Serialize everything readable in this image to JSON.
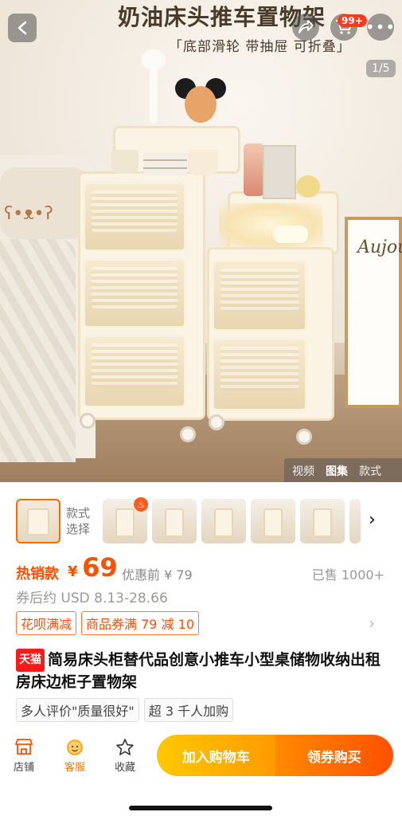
{
  "hero": {
    "title": "奶油床头推车置物架",
    "subtitle": "「底部滑轮 带抽屉 可折叠」",
    "cart_badge": "99+",
    "image_counter": "1/5",
    "media_tabs": [
      "视频",
      "图集",
      "款式"
    ],
    "active_media_tab": "图集",
    "frame_text": "Aujou"
  },
  "thumbs": {
    "style_label": "款式选择"
  },
  "price": {
    "hot_label": "热销款",
    "currency": "¥",
    "value": "69",
    "original": "优惠前 ¥ 79",
    "sold": "已售 1000+",
    "usd": "券后约 USD 8.13-28.66"
  },
  "promos": [
    "花呗满减",
    "商品券满 79 减 10"
  ],
  "product": {
    "badge": "天猫",
    "title": "简易床头柜替代品创意小推车小型桌储物收纳出租房床边柜子置物架"
  },
  "tags": [
    "多人评价\"质量很好\"",
    "超 3 千人加购"
  ],
  "bottom_bar": {
    "shop": "店铺",
    "service": "客服",
    "favorite": "收藏",
    "add_to_cart": "加入购物车",
    "buy": "领券购买"
  },
  "colors": {
    "accent": "#ff5000",
    "cart_gradient": [
      "#ffc800",
      "#ff9a00"
    ],
    "buy_gradient": [
      "#ff8a00",
      "#ff5000"
    ],
    "tmall_red": "#ff1a1a"
  }
}
